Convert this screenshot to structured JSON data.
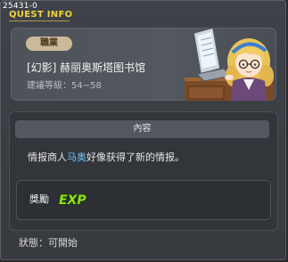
{
  "window": {
    "quest_id": "25431-0",
    "title": "QUEST INFO"
  },
  "header": {
    "job_badge": "職業",
    "quest_name": "[幻影] 赫丽奥斯塔图书馆",
    "level_requirement": "建議等級：54~58"
  },
  "content": {
    "section_title": "內容",
    "description_before": "情报商人",
    "description_highlight": "马奥",
    "description_after": "好像获得了新的情报。"
  },
  "reward": {
    "label": "獎勵",
    "exp_text": "EXP"
  },
  "status": {
    "text": "狀態：可開始"
  },
  "colors": {
    "title": "#f2d43a",
    "highlight_name": "#72c7ff",
    "exp_fill": "#8fe21b"
  }
}
